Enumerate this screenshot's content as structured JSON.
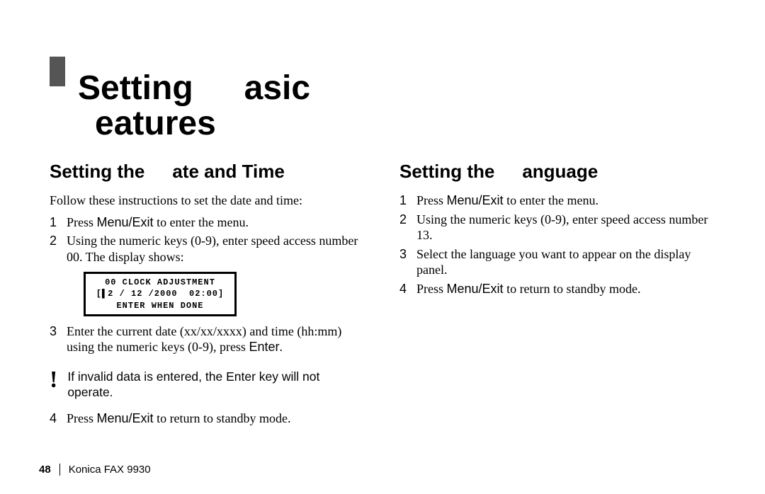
{
  "chapter": {
    "line1": "Setting   asic",
    "line2": " eatures"
  },
  "left": {
    "heading": "Setting the   ate and Time",
    "intro": "Follow these instructions to set the date and time:",
    "step1_a": "Press ",
    "step1_kw": "Menu/Exit",
    "step1_b": " to enter the menu.",
    "step2": "Using the numeric keys (0-9), enter speed access number 00. The display shows:",
    "lcd_line1": "00 CLOCK ADJUSTMENT",
    "lcd_line2": "[▌2 / 12 /2000  02:00]",
    "lcd_line3": "ENTER WHEN DONE",
    "step3_a": "Enter the current date (xx/xx/xxxx) and time (hh:mm) using the numeric keys (0-9), press ",
    "step3_kw": "Enter",
    "step3_b": ".",
    "caution": "If invalid data is entered, the Enter key will not operate.",
    "step4_a": "Press ",
    "step4_kw": "Menu/Exit",
    "step4_b": " to return to standby mode."
  },
  "right": {
    "heading": "Setting the   anguage",
    "step1_a": "Press ",
    "step1_kw": "Menu/Exit",
    "step1_b": " to enter the menu.",
    "step2": "Using the numeric keys (0-9), enter speed access number 13.",
    "step3": "Select the language you want to appear on the display panel.",
    "step4_a": "Press ",
    "step4_kw": "Menu/Exit",
    "step4_b": " to return to standby mode."
  },
  "footer": {
    "page": "48",
    "doc": "Konica FAX 9930"
  },
  "nums": {
    "n1": "1",
    "n2": "2",
    "n3": "3",
    "n4": "4"
  },
  "icons": {
    "caution": "!"
  }
}
